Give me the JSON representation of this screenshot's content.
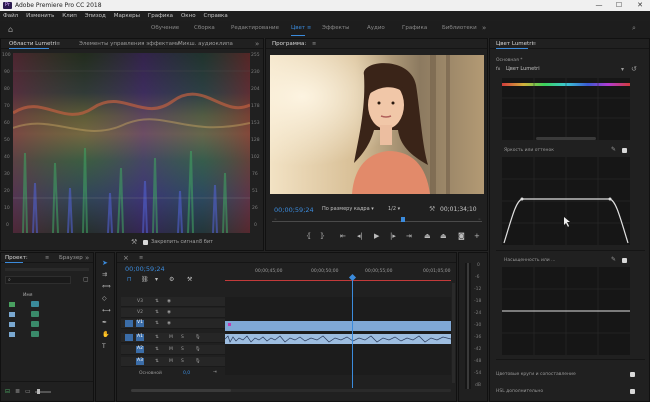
{
  "titlebar": {
    "logo": "Pr",
    "title": "Adobe Premiere Pro CC 2018",
    "minimize": "—",
    "maximize": "☐",
    "close": "✕"
  },
  "menu": [
    "Файл",
    "Изменить",
    "Клип",
    "Эпизод",
    "Маркеры",
    "Графика",
    "Окно",
    "Справка"
  ],
  "workspaces": [
    "Обучение",
    "Сборка",
    "Редактирование",
    "Цвет",
    "Эффекты",
    "Аудио",
    "Графика",
    "Библиотеки"
  ],
  "workspace_active": "Цвет",
  "scopes_panel": {
    "tabs": [
      "Области Lumetri",
      "Элементы управления эффектами",
      "Микш. аудиоклипа"
    ],
    "left_scale": [
      "100",
      "90",
      "80",
      "70",
      "60",
      "50",
      "40",
      "30",
      "20",
      "10",
      "0"
    ],
    "right_scale": [
      "255",
      "230",
      "204",
      "178",
      "153",
      "128",
      "102",
      "76",
      "51",
      "26",
      "0"
    ],
    "footer_checkbox": "Закрепить сигнал",
    "footer_bits": "8 бит"
  },
  "program": {
    "tab": "Программа:",
    "timecode": "00;00;59;24",
    "fit": "По размеру кадра",
    "quality": "1/2",
    "duration": "00;01;34;10"
  },
  "lumetri": {
    "title": "Цвет Lumetri",
    "section_main": "Основная *",
    "fx_label": "fx",
    "fx_name": "Цвет Lumetri",
    "curve1_label": "Яркость или оттенок",
    "curve2_label": "Насыщенность или ...",
    "bottom1": "Цветовые круги и сопоставление",
    "bottom2": "HSL дополнительно"
  },
  "project": {
    "tabs": [
      "Проект:",
      "Браузер"
    ],
    "column": "Имя",
    "items": 4
  },
  "timeline": {
    "timecode": "00;00;59;24",
    "ruler": [
      "00;00;45;00",
      "00;00;50;00",
      "00;00;55;00",
      "00;01;00;00",
      "00;01;05;00"
    ],
    "tracks_video": [
      "V3",
      "V2",
      "V1"
    ],
    "tracks_audio": [
      "A1",
      "A2",
      "A3"
    ],
    "master": "Основной",
    "master_value": "0,0",
    "playhead_fraction": 0.56
  },
  "meters_scale": [
    "0",
    "-6",
    "-12",
    "-18",
    "-24",
    "-30",
    "-36",
    "-42",
    "-48",
    "-54",
    "dB"
  ],
  "colors": {
    "accent": "#3b8bdc",
    "playhead": "#3b8bdc",
    "clip": "#7fa8d6"
  }
}
